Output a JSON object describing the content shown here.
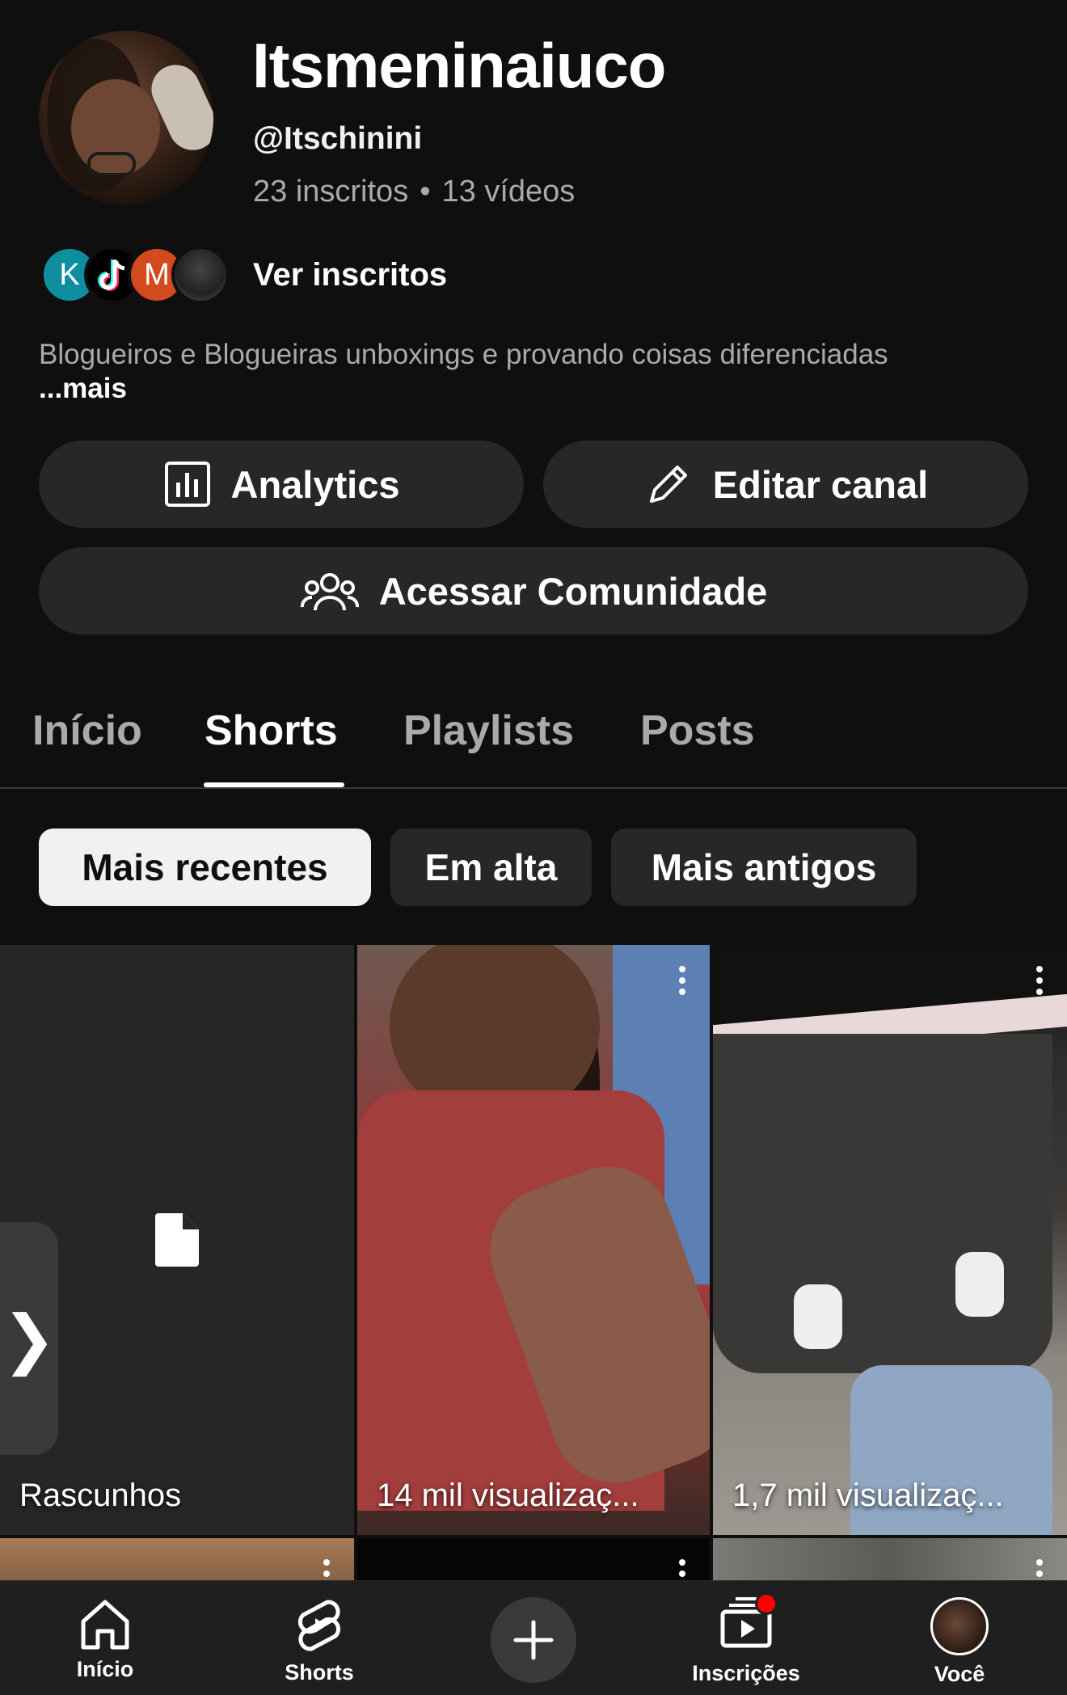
{
  "channel": {
    "name": "Itsmeninaiuco",
    "handle": "@Itschinini",
    "subscribers": "23 inscritos",
    "separator": "•",
    "videos": "13 vídeos",
    "view_subscribers": "Ver inscritos",
    "subscriber_avatars": [
      "K",
      "",
      "M",
      ""
    ],
    "bio": "Blogueiros e Blogueiras unboxings e provando coisas diferenciadas",
    "bio_more": "...mais"
  },
  "actions": {
    "analytics": "Analytics",
    "edit_channel": "Editar canal",
    "community": "Acessar Comunidade"
  },
  "tabs": [
    {
      "label": "Início",
      "active": false
    },
    {
      "label": "Shorts",
      "active": true
    },
    {
      "label": "Playlists",
      "active": false
    },
    {
      "label": "Posts",
      "active": false
    }
  ],
  "filters": [
    {
      "label": "Mais recentes",
      "active": true
    },
    {
      "label": "Em alta",
      "active": false
    },
    {
      "label": "Mais antigos",
      "active": false
    }
  ],
  "grid": {
    "drafts_label": "Rascunhos",
    "videos": [
      {
        "views": "14 mil visualizaç..."
      },
      {
        "views": "1,7 mil visualizaç..."
      }
    ]
  },
  "bottom_nav": {
    "home": "Início",
    "shorts": "Shorts",
    "subscriptions": "Inscrições",
    "you": "Você"
  },
  "colors": {
    "background": "#0f0f0f",
    "surface": "#272727",
    "notification": "#ff0000"
  }
}
